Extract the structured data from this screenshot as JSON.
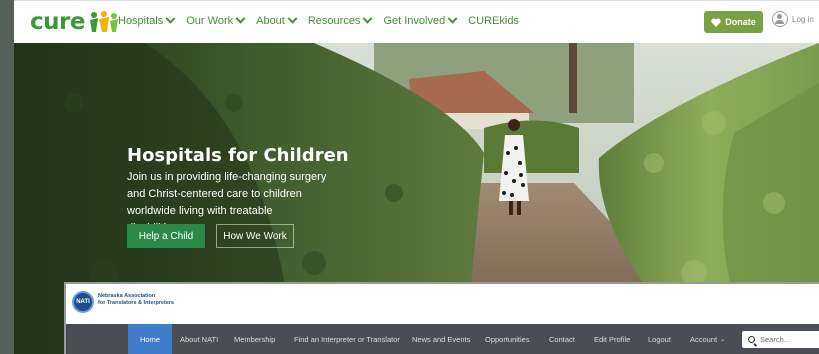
{
  "cure": {
    "logo_text": "cure",
    "nav": [
      {
        "label": "Hospitals",
        "has_dropdown": true
      },
      {
        "label": "Our Work",
        "has_dropdown": true
      },
      {
        "label": "About",
        "has_dropdown": true
      },
      {
        "label": "Resources",
        "has_dropdown": true
      },
      {
        "label": "Get Involved",
        "has_dropdown": true
      },
      {
        "label": "CUREkids",
        "has_dropdown": false
      }
    ],
    "donate_label": "Donate",
    "login_label": "Log in",
    "hero": {
      "title": "Hospitals for Children",
      "subtitle": "Join us in providing life-changing surgery and Christ-centered care to children worldwide living with treatable disabilities.",
      "primary_button": "Help a Child",
      "secondary_button": "How We Work"
    },
    "colors": {
      "brand_green": "#3a9a3a",
      "donate": "#7ba146",
      "cta": "#2a8a45"
    }
  },
  "nati": {
    "logo_text": "NATI",
    "org_name_line1": "Nebraska Association",
    "org_name_line2": "for Translators & Interpreters",
    "nav": [
      {
        "label": "Home",
        "active": true
      },
      {
        "label": "About NATI"
      },
      {
        "label": "Membership"
      },
      {
        "label": "Find an Interpreter or Translator"
      },
      {
        "label": "News and Events"
      },
      {
        "label": "Opportunities"
      },
      {
        "label": "Contact"
      },
      {
        "label": "Edit Profile"
      },
      {
        "label": "Logout"
      },
      {
        "label": "Account"
      }
    ],
    "search_placeholder": "Search...",
    "colors": {
      "nav_bg": "#4a4d53",
      "active": "#3f7cc9"
    }
  }
}
